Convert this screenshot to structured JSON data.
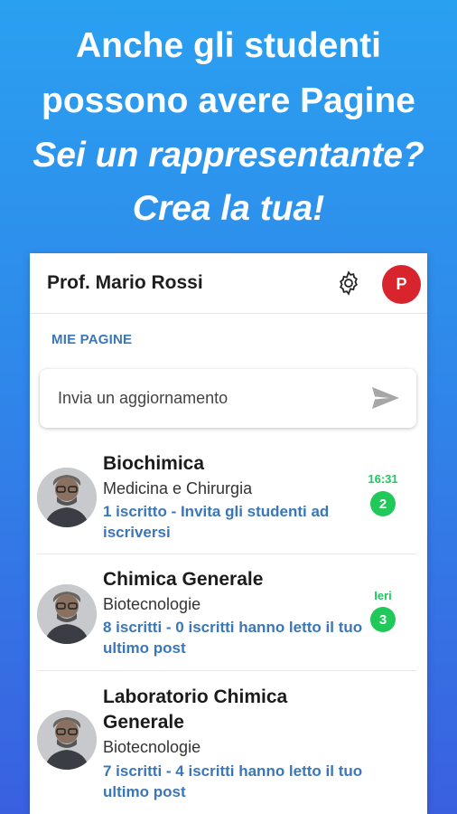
{
  "promo": {
    "line1": "Anche gli studenti",
    "line2": "possono avere Pagine",
    "line3": "Sei un rappresentante?",
    "line4": "Crea la tua!"
  },
  "appbar": {
    "title": "Prof. Mario Rossi",
    "avatar_letter": "P"
  },
  "section_label": "MIE PAGINE",
  "compose": {
    "placeholder": "Invia un aggiornamento"
  },
  "pages": [
    {
      "name": "Biochimica",
      "subtitle": "Medicina e Chirurgia",
      "stats": "1 iscritto - Invita gli studenti ad iscriversi",
      "time": "16:31",
      "count": "2"
    },
    {
      "name": "Chimica Generale",
      "subtitle": "Biotecnologie",
      "stats": "8 iscritti - 0 iscritti hanno letto il tuo ultimo post",
      "time": "Ieri",
      "count": "3"
    },
    {
      "name": "Laboratorio Chimica Generale",
      "subtitle": "Biotecnologie",
      "stats": "7 iscritti - 4 iscritti hanno letto il tuo ultimo post"
    }
  ],
  "colors": {
    "accent_blue": "#3a77b8",
    "badge_green": "#21c85a",
    "avatar_red": "#d8242c"
  }
}
